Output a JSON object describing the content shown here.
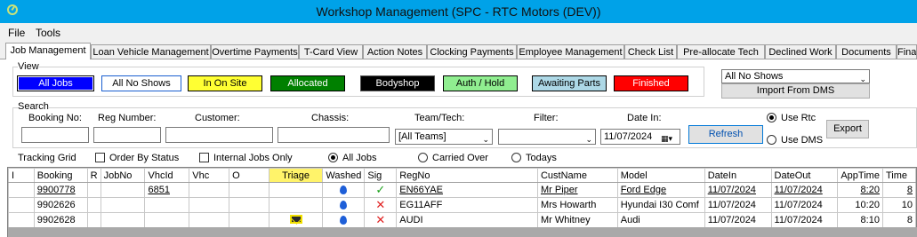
{
  "window": {
    "title": "Workshop Management   (SPC - RTC Motors (DEV))",
    "icon": "app-logo-icon",
    "accent": "#00a2e8"
  },
  "menu": [
    "File",
    "Tools"
  ],
  "tabs": [
    "Job Management",
    "Loan Vehicle Management",
    "Overtime Payments",
    "T-Card View",
    "Action Notes",
    "Clocking Payments",
    "Employee Management",
    "Check List",
    "Pre-allocate Tech",
    "Declined Work",
    "Documents",
    "Fina"
  ],
  "view": {
    "label": "View",
    "buttons": [
      {
        "label": "All Jobs",
        "bg": "#0000ff",
        "fg": "#ffffff"
      },
      {
        "label": "All No Shows",
        "bg": "#ffffff",
        "fg": "#000000"
      },
      {
        "label": "In On Site",
        "bg": "#ffff33",
        "fg": "#000000"
      },
      {
        "label": "Allocated",
        "bg": "#008000",
        "fg": "#ffffff"
      },
      {
        "label": "Bodyshop",
        "bg": "#000000",
        "fg": "#ffffff"
      },
      {
        "label": "Auth / Hold",
        "bg": "#90ee90",
        "fg": "#000000"
      },
      {
        "label": "Awaiting Parts",
        "bg": "#add8e6",
        "fg": "#000000"
      },
      {
        "label": "Finished",
        "bg": "#ff0000",
        "fg": "#ffffff"
      }
    ],
    "filter_select": "All No Shows",
    "import_button": "Import From DMS"
  },
  "search": {
    "label": "Search",
    "booking_no_label": "Booking No:",
    "reg_number_label": "Reg Number:",
    "customer_label": "Customer:",
    "chassis_label": "Chassis:",
    "team_tech_label": "Team/Tech:",
    "team_value": "[All Teams]",
    "filter_label": "Filter:",
    "date_in_label": "Date In:",
    "date_in_value": "11/07/2024",
    "refresh_button": "Refresh",
    "use_rtc": "Use Rtc",
    "use_dms": "Use DMS",
    "export_button": "Export"
  },
  "tracking": {
    "label": "Tracking Grid",
    "order_by_status": "Order By Status",
    "internal_jobs_only": "Internal Jobs Only",
    "all_jobs": "All Jobs",
    "carried_over": "Carried Over",
    "todays": "Todays"
  },
  "grid": {
    "columns": [
      "I",
      "Booking",
      "R",
      "JobNo",
      "VhcId",
      "Vhc",
      "O",
      "Triage",
      "Washed",
      "Sig",
      "RegNo",
      "CustName",
      "Model",
      "DateIn",
      "DateOut",
      "AppTime",
      "Time"
    ],
    "rows": [
      {
        "booking": "9900778",
        "vhcid": "6851",
        "triage": "",
        "washed": "water-drop-icon",
        "sig": "tick",
        "regno": "EN66YAE",
        "custname": "Mr Piper",
        "model": "Ford Edge",
        "datein": "11/07/2024",
        "dateout": "11/07/2024",
        "apptime": "8:20",
        "time": "8"
      },
      {
        "booking": "9902626",
        "vhcid": "",
        "triage": "",
        "washed": "water-drop-icon",
        "sig": "cross",
        "regno": "EG11AFF",
        "custname": "Mrs Howarth",
        "model": "Hyundai I30 Comf",
        "datein": "11/07/2024",
        "dateout": "11/07/2024",
        "apptime": "10:20",
        "time": "10"
      },
      {
        "booking": "9902628",
        "vhcid": "",
        "triage": "envelope-icon",
        "washed": "water-drop-icon",
        "sig": "cross",
        "regno": "AUDI",
        "custname": "Mr Whitney",
        "model": "Audi",
        "datein": "11/07/2024",
        "dateout": "11/07/2024",
        "apptime": "8:10",
        "time": "8"
      }
    ]
  }
}
